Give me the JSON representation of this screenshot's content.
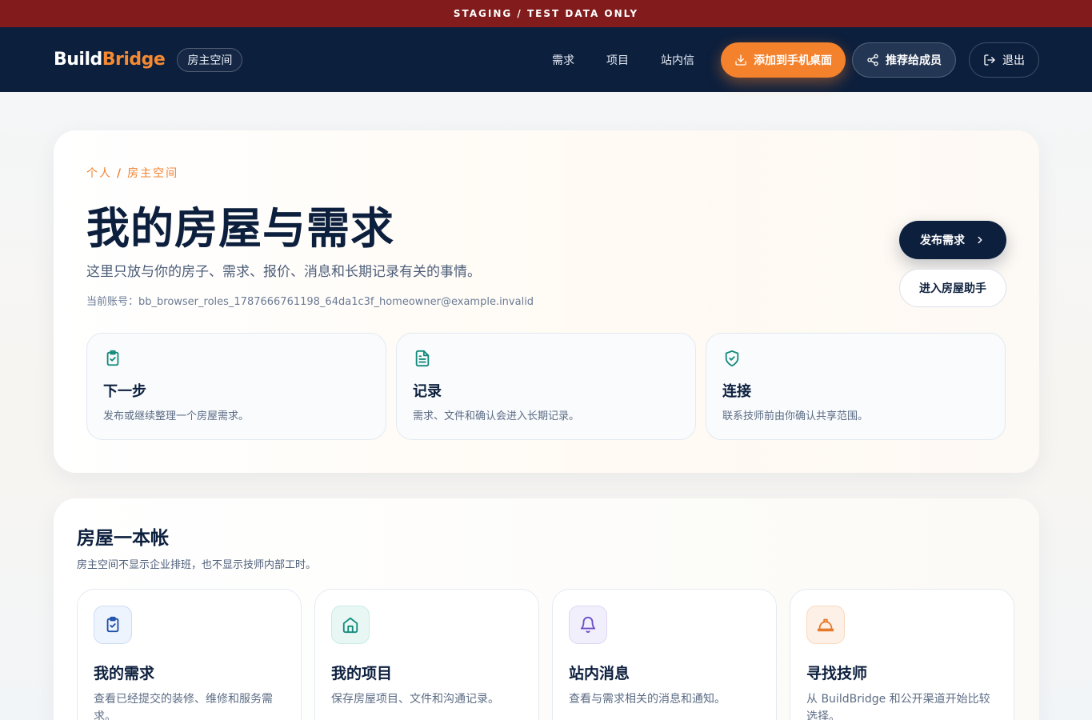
{
  "banner": {
    "text": "STAGING / TEST DATA ONLY"
  },
  "nav": {
    "logo_part1": "Build",
    "logo_part2": "Bridge",
    "space_label": "房主空间",
    "links": [
      "需求",
      "项目",
      "站内信"
    ],
    "add_home_label": "添加到手机桌面",
    "recommend_label": "推荐给成员",
    "logout_label": "退出"
  },
  "hero": {
    "crumb_1": "个人",
    "crumb_sep": "/",
    "crumb_2": "房主空间",
    "title": "我的房屋与需求",
    "subtitle": "这里只放与你的房子、需求、报价、消息和长期记录有关的事情。",
    "account_text": "当前账号：bb_browser_roles_1787666761198_64da1c3f_homeowner@example.invalid",
    "publish_label": "发布需求",
    "assistant_label": "进入房屋助手",
    "cards": [
      {
        "icon": "clipboard-check-icon",
        "title": "下一步",
        "desc": "发布或继续整理一个房屋需求。"
      },
      {
        "icon": "document-icon",
        "title": "记录",
        "desc": "需求、文件和确认会进入长期记录。"
      },
      {
        "icon": "shield-check-icon",
        "title": "连接",
        "desc": "联系技师前由你确认共享范围。"
      }
    ]
  },
  "ledger": {
    "title": "房屋一本帐",
    "subtitle": "房主空间不显示企业排班，也不显示技师内部工时。",
    "cards": [
      {
        "icon": "clipboard-check-icon",
        "title": "我的需求",
        "desc": "查看已经提交的装修、维修和服务需求。",
        "accent": "#1d4ea8",
        "bg": "#eef4fd"
      },
      {
        "icon": "home-icon",
        "title": "我的项目",
        "desc": "保存房屋项目、文件和沟通记录。",
        "accent": "#138a7c",
        "bg": "#e9f7f4"
      },
      {
        "icon": "bell-icon",
        "title": "站内消息",
        "desc": "查看与需求相关的消息和通知。",
        "accent": "#6a4fc4",
        "bg": "#f2effc"
      },
      {
        "icon": "hard-hat-icon",
        "title": "寻找技师",
        "desc": "从 BuildBridge 和公开渠道开始比较选择。",
        "accent": "#e67a2c",
        "bg": "#fdf1e7"
      }
    ]
  },
  "colors": {
    "navy": "#0c1f3d",
    "orange": "#f4812c",
    "banner": "#811b1c",
    "teal": "#138a7c"
  }
}
